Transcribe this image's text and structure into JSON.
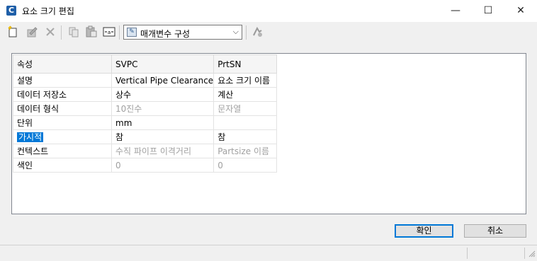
{
  "window": {
    "app_icon_letter": "C",
    "title": "요소 크기 편집",
    "minimize_glyph": "—",
    "maximize_glyph": "☐",
    "close_glyph": "✕"
  },
  "toolbar": {
    "icons": [
      "new-parameter-icon",
      "edit-icon",
      "delete-icon",
      "copy-icon",
      "paste-icon",
      "size-parameter-icon",
      "calculator-icon"
    ],
    "param_config_label": "매개변수 구성"
  },
  "grid": {
    "headers": [
      "속성",
      "SVPC",
      "PrtSN"
    ],
    "rows": [
      {
        "prop": "설명",
        "svpc": "Vertical Pipe Clearance",
        "prtsn": "요소 크기 이름",
        "dim": false,
        "selected": false
      },
      {
        "prop": "데이터 저장소",
        "svpc": "상수",
        "prtsn": "계산",
        "dim": false,
        "selected": false
      },
      {
        "prop": "데이터 형식",
        "svpc": "10진수",
        "prtsn": "문자열",
        "dim": true,
        "selected": false
      },
      {
        "prop": "단위",
        "svpc": "mm",
        "prtsn": "",
        "dim": false,
        "selected": false
      },
      {
        "prop": "가시적",
        "svpc": "참",
        "prtsn": "참",
        "dim": false,
        "selected": true
      },
      {
        "prop": "컨텍스트",
        "svpc": "수직 파이프 이격거리",
        "prtsn": "Partsize 이름",
        "dim": true,
        "selected": false
      },
      {
        "prop": "색인",
        "svpc": "0",
        "prtsn": "0",
        "dim": true,
        "selected": false
      }
    ]
  },
  "buttons": {
    "ok": "확인",
    "cancel": "취소"
  }
}
